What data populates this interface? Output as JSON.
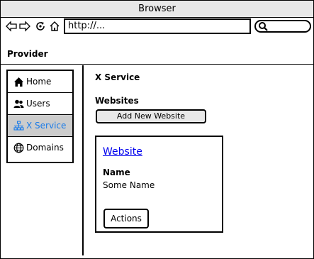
{
  "window": {
    "title": "Browser"
  },
  "toolbar": {
    "address": "http://..."
  },
  "provider": {
    "title": "Provider"
  },
  "sidebar": {
    "items": [
      {
        "label": "Home",
        "icon": "home-icon",
        "active": false
      },
      {
        "label": "Users",
        "icon": "users-icon",
        "active": false
      },
      {
        "label": "X Service",
        "icon": "network-icon",
        "active": true
      },
      {
        "label": "Domains",
        "icon": "globe-icon",
        "active": false
      }
    ]
  },
  "main": {
    "title": "X Service",
    "websites_label": "Websites",
    "add_button": "Add New Website",
    "card": {
      "link": "Website",
      "name_label": "Name",
      "name_value": "Some Name",
      "actions_button": "Actions"
    }
  },
  "colors": {
    "active_text": "#1a7be8",
    "active_bg": "#cccccc",
    "link": "#0000ee"
  }
}
